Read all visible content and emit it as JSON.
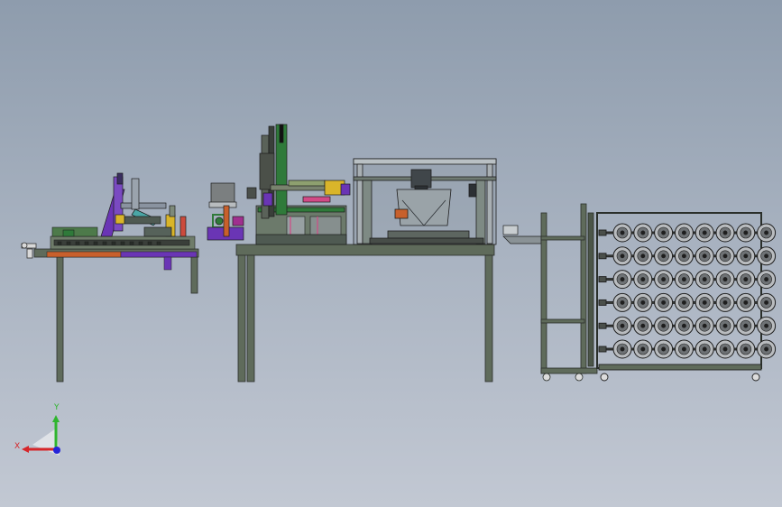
{
  "viewport": {
    "background_top": "#8e9cad",
    "background_bottom": "#c2c8d3"
  },
  "triad": {
    "x_label": "X",
    "y_label": "Y",
    "x_color": "#d6262a",
    "y_color": "#2fb52f",
    "z_color": "#2424d8"
  },
  "machine": {
    "frame_color": "#5f6b5b",
    "outline_color": "#2b2f2b",
    "accent_purple": "#6a35b5",
    "accent_orange": "#c8602c",
    "accent_green": "#2f7a3a",
    "accent_yellow": "#d9b52a",
    "reel_rows": 6,
    "reel_columns": 8
  }
}
